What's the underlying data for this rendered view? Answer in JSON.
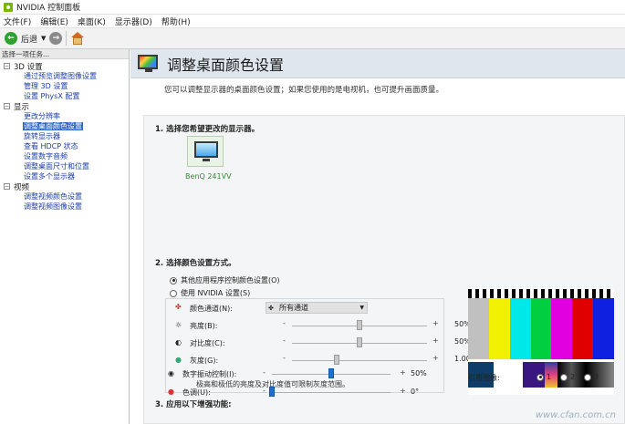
{
  "window": {
    "title": "NVIDIA 控制面板"
  },
  "menu": [
    "文件(F)",
    "编辑(E)",
    "桌面(K)",
    "显示器(D)",
    "帮助(H)"
  ],
  "toolbar": {
    "back_label": "后退"
  },
  "left_panel": {
    "header": "选择一项任务...",
    "tree": [
      {
        "category": "3D 设置",
        "items": [
          "通过预览调整图像设置",
          "管理 3D 设置",
          "设置 PhysX 配置"
        ]
      },
      {
        "category": "显示",
        "items": [
          "更改分辨率",
          "调整桌面颜色设置",
          "旋转显示器",
          "查看 HDCP 状态",
          "设置数字音频",
          "调整桌面尺寸和位置",
          "设置多个显示器"
        ]
      },
      {
        "category": "视频",
        "items": [
          "调整视频颜色设置",
          "调整视频图像设置"
        ]
      }
    ],
    "selected_item": "调整桌面颜色设置"
  },
  "page": {
    "title": "调整桌面颜色设置",
    "description": "您可以调整显示器的桌面颜色设置；如果您使用的是电视机，也可提升画面质量。",
    "section1": {
      "title": "1. 选择您希望更改的显示器。",
      "display_name": "BenQ 241VV"
    },
    "section2": {
      "title": "2. 选择颜色设置方式。",
      "option_other": "其他应用程序控制颜色设置(O)",
      "option_nvidia": "使用 NVIDIA 设置(S)",
      "selected_option": "other",
      "channel_label": "颜色通道(N):",
      "channel_value": "所有通道",
      "brightness": {
        "label": "亮度(B):",
        "value": "50%",
        "level": 0.5
      },
      "contrast": {
        "label": "对比度(C):",
        "value": "50%",
        "level": 0.5
      },
      "gamma": {
        "label": "灰度(G):",
        "value": "1.00",
        "level": 0.33
      },
      "note": "极高和极低的亮度及对比度值可限制灰度范围。"
    },
    "section3": {
      "title": "3. 应用以下增强功能:",
      "vibrance": {
        "label": "数字振动控制(I):",
        "value": "50%",
        "level": 0.5
      },
      "hue": {
        "label": "色调(U):",
        "value": "0°",
        "level": 0.0
      }
    },
    "reference": {
      "label": "引用图像:",
      "options": [
        "1",
        "2",
        "3"
      ],
      "selected": "1"
    }
  },
  "colors": {
    "accent": "#76b900",
    "selection": "#3169c6",
    "link": "#1a3ea8",
    "header_bg": "#dfe6ee"
  },
  "watermark": "www.cfan.com.cn"
}
